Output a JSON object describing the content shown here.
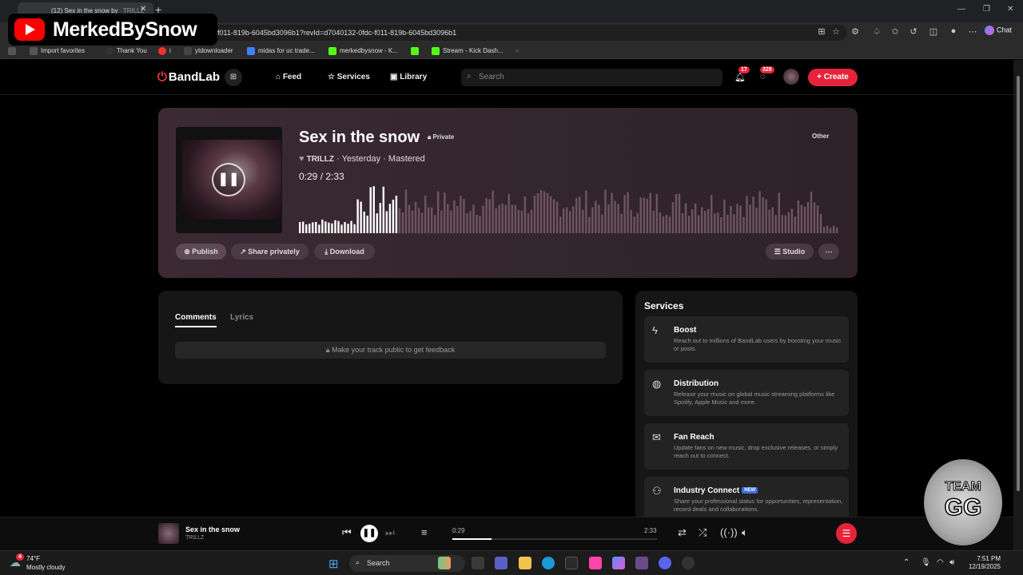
{
  "browser": {
    "tab_title": "(12) Sex in the snow by",
    "tab_suffix": "TRILLZ",
    "url": "f011-819b-6045bd3096b1?revId=d7040132-0fdc-f011-819b-6045bd3096b1",
    "chat_label": "Chat",
    "favorites": [
      {
        "label": "Import favorites",
        "color": "#555"
      },
      {
        "label": "Thank You",
        "color": "#333"
      },
      {
        "label": "i",
        "color": "#e33"
      },
      {
        "label": "ytdownloader",
        "color": "#444"
      },
      {
        "label": "midas for uc trade...",
        "color": "#3b82f6"
      },
      {
        "label": "merkedbysnow - K...",
        "color": "#53fc18"
      },
      {
        "label": "",
        "color": "#53fc18"
      },
      {
        "label": "Stream - Kick Dash...",
        "color": "#53fc18"
      }
    ]
  },
  "overlay": {
    "channel_name": "MerkedBySnow",
    "badge_line1": "TEAM",
    "badge_line2": "GG"
  },
  "nav": {
    "brand": "BandLab",
    "feed": "Feed",
    "services": "Services",
    "library": "Library",
    "search_placeholder": "Search",
    "notifications_count": "17",
    "messages_count": "328",
    "create": "Create"
  },
  "track": {
    "title": "Sex in the snow",
    "visibility": "Private",
    "genre": "Other",
    "artist": "TRILLZ",
    "meta": "· Yesterday · Mastered",
    "current_time": "0:29",
    "duration": "2:33",
    "progress": 0.19,
    "actions": {
      "publish": "Publish",
      "share": "Share privately",
      "download": "Download",
      "studio": "Studio"
    }
  },
  "comments": {
    "tab_comments": "Comments",
    "tab_lyrics": "Lyrics",
    "feedback_notice": "Make your track public to get feedback"
  },
  "services_panel": {
    "heading": "Services",
    "items": [
      {
        "title": "Boost",
        "desc": "Reach out to millions of BandLab users by boosting your music or posts.",
        "icon": "bolt-icon"
      },
      {
        "title": "Distribution",
        "desc": "Release your music on global music streaming platforms like Spotify, Apple Music and more.",
        "icon": "globe-icon"
      },
      {
        "title": "Fan Reach",
        "desc": "Update fans on new music, drop exclusive releases, or simply reach out to connect.",
        "icon": "mail-icon"
      },
      {
        "title": "Industry Connect",
        "desc": "Share your professional status for opportunities, representation, record deals and collaborations.",
        "icon": "people-icon",
        "badge": "NEW"
      }
    ]
  },
  "player": {
    "title": "Sex in the snow",
    "artist": "TRILLZ",
    "current_time": "0:29",
    "duration": "2:33",
    "progress": 0.19
  },
  "taskbar": {
    "temp": "74°F",
    "condition": "Mostly cloudy",
    "weather_badge": "4",
    "search": "Search",
    "time": "7:51 PM",
    "date": "12/19/2025"
  },
  "colors": {
    "accent": "#e5243b",
    "card": "#3b2a33"
  }
}
